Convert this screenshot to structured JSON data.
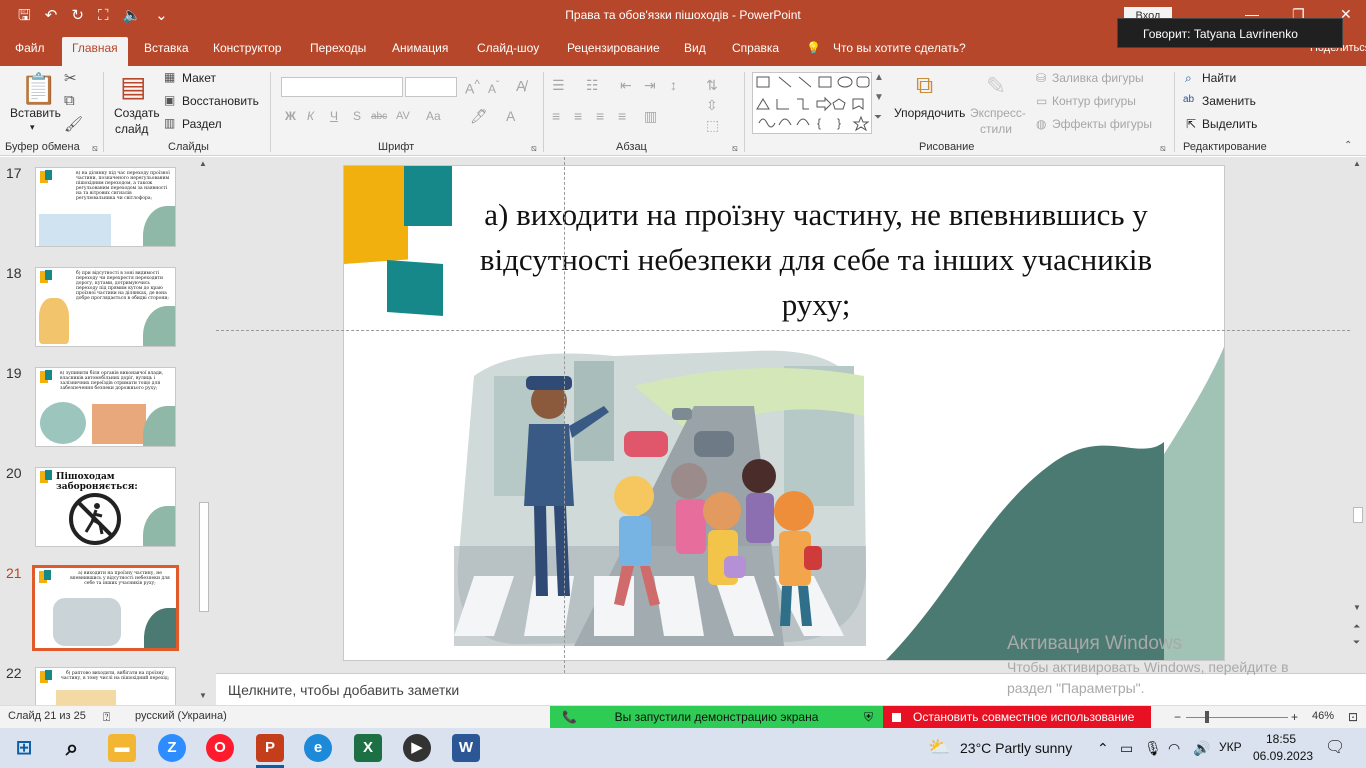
{
  "window": {
    "title": "Права та обов'язки пішоходів  -  PowerPoint",
    "login_label": "Вход",
    "speaker_tooltip": "Говорит: Tatyana Lavrinenko",
    "share_label": "Поделиться"
  },
  "tabs": [
    "Файл",
    "Главная",
    "Вставка",
    "Конструктор",
    "Переходы",
    "Анимация",
    "Слайд-шоу",
    "Рецензирование",
    "Вид",
    "Справка",
    "Что вы хотите сделать?"
  ],
  "ribbon": {
    "clipboard": {
      "paste": "Вставить",
      "group": "Буфер обмена"
    },
    "slides": {
      "new_slide_1": "Создать",
      "new_slide_2": "слайд",
      "layout": "Макет",
      "reset": "Восстановить",
      "section": "Раздел",
      "group": "Слайды"
    },
    "font": {
      "bold": "Ж",
      "italic": "К",
      "underline": "Ч",
      "shadow": "S",
      "strike": "abc",
      "spacing": "AV",
      "case": "Aa",
      "group": "Шрифт"
    },
    "paragraph": {
      "group": "Абзац"
    },
    "drawing": {
      "arrange": "Упорядочить",
      "quick_styles_1": "Экспресс-",
      "quick_styles_2": "стили",
      "fill": "Заливка фигуры",
      "outline": "Контур фигуры",
      "effects": "Эффекты фигуры",
      "group": "Рисование"
    },
    "editing": {
      "find": "Найти",
      "replace": "Заменить",
      "select": "Выделить",
      "group": "Редактирование"
    }
  },
  "slides": [
    {
      "num": "17",
      "text": "в) на ділянку під час переходу проїзної частини, позначеного нерегульованим пішохідним переходом, а також регульованим переходом за наявності на та вітрових сигналів регулювальника чи світлофора;"
    },
    {
      "num": "18",
      "text": "б) при відсутності в зоні видимості переходу чи перехрестя переходити дорогу, кутами, дотримуючись переходу під прямим кутом до краю проїзної частини на ділянках, де вона добре проглядається в обидві сторони;"
    },
    {
      "num": "19",
      "text": "в) зупинити біля органів виконавчої влади, власників автомобільних доріг, вулиць і залізничних переїздів отримати тощо для забезпечення безпеки дорожнього руху;"
    },
    {
      "num": "20",
      "text": "Пішоходам забороняється:"
    },
    {
      "num": "21",
      "text": "а) виходити на проїзну частину, не впевнившись у відсутності небезпеки для себе та інших учасників руху;"
    },
    {
      "num": "22",
      "text": "б) раптово виходити, вибігати на проїзну частину, в тому числі на пішохідний перехід;"
    }
  ],
  "current_slide": {
    "title": "а) виходити на проїзну частину, не впевнившись у відсутності небезпеки для себе та інших учасників руху;"
  },
  "notes_placeholder": "Щелкните, чтобы добавить заметки",
  "activation": {
    "line1": "Активация Windows",
    "line2": "Чтобы активировать Windows, перейдите в",
    "line3": "раздел \"Параметры\"."
  },
  "status": {
    "slide_counter": "Слайд 21 из 25",
    "language": "русский (Украина)",
    "share_msg": "Вы запустили демонстрацию экрана",
    "stop_share": "Остановить совместное использование",
    "zoom": "46%"
  },
  "taskbar": {
    "weather": "23°C  Partly sunny",
    "lang": "УКР",
    "time": "18:55",
    "date": "06.09.2023"
  },
  "colors": {
    "accent": "#b7472a",
    "teal": "#17888a",
    "yellow": "#f1b00e",
    "sage": "#8fb8a8",
    "dark_teal": "#4a7a72"
  }
}
